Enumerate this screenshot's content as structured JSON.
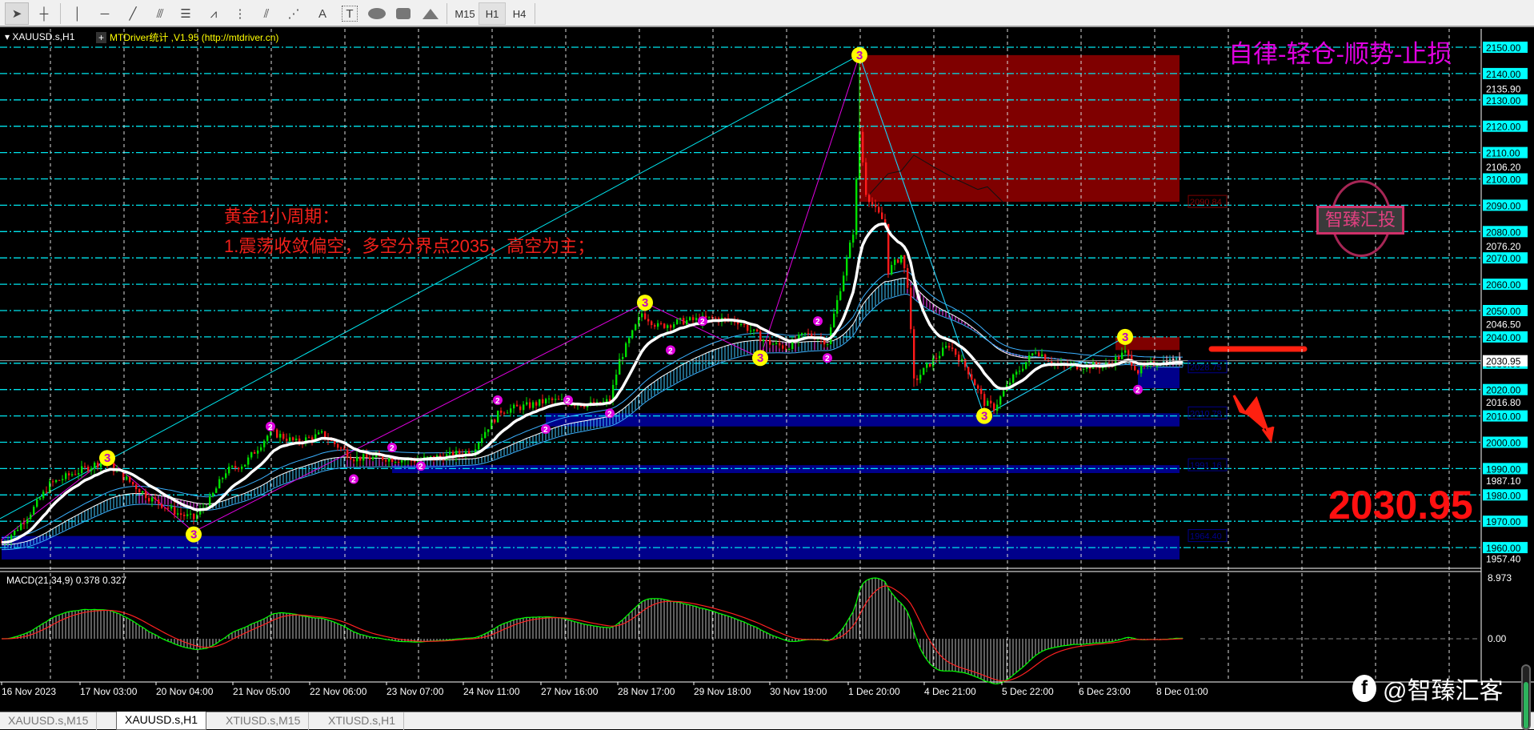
{
  "toolbar": {
    "tools": [
      "cursor",
      "crosshair",
      "vertical-line",
      "horizontal-line",
      "trendline",
      "equidistant-channel",
      "fibonacci-retracement",
      "fibonacci-fan",
      "fibonacci-timezones",
      "fibonacci-channel",
      "gann-fan",
      "text",
      "text-label",
      "ellipse",
      "rectangle",
      "triangle"
    ],
    "text_tool": "A",
    "label_tool": "T",
    "timeframes": [
      "M15",
      "H1",
      "H4"
    ],
    "active_timeframe": "H1"
  },
  "chart": {
    "symbol_label": "XAUUSD.s,H1",
    "indicator_label": "MTDriver统计 ,V1.95 (http://mtdriver.cn)",
    "slogan": "自律-轻仓-顺势-止损",
    "analysis_title": "黄金1小周期：",
    "analysis_line1": "1.震荡收敛偏空，多空分界点2035，高空为主；",
    "big_price": "2030.95",
    "stamp_text": "智臻汇投",
    "stamp_ring_text": "checked",
    "watermark": "@智臻汇客",
    "current_price": 2030.95,
    "current_price_label": "2030.95",
    "price_axis_major": [
      "2150.00",
      "2140.00",
      "2130.00",
      "2120.00",
      "2110.00",
      "2100.00",
      "2090.00",
      "2080.00",
      "2070.00",
      "2060.00",
      "2050.00",
      "2040.00",
      "2030.00",
      "2020.00",
      "2010.00",
      "2000.00",
      "1990.00",
      "1980.00",
      "1970.00",
      "1960.00"
    ],
    "price_axis_minor": [
      "2135.90",
      "2106.20",
      "2076.20",
      "2046.50",
      "2016.80",
      "1987.10",
      "1957.40"
    ],
    "time_labels": [
      "16 Nov 2023",
      "17 Nov 03:00",
      "20 Nov 04:00",
      "21 Nov 05:00",
      "22 Nov 06:00",
      "23 Nov 07:00",
      "24 Nov 11:00",
      "27 Nov 16:00",
      "28 Nov 17:00",
      "29 Nov 18:00",
      "30 Nov 19:00",
      "1 Dec 20:00",
      "4 Dec 21:00",
      "5 Dec 22:00",
      "6 Dec 23:00",
      "8 Dec 01:00"
    ],
    "zones": [
      {
        "kind": "resistance",
        "color": "#7f0000",
        "from_bar": 268,
        "to_bar": 368,
        "top": 2147,
        "bottom": 2091.3,
        "label": "2090.84"
      },
      {
        "kind": "resistance",
        "color": "#7f0000",
        "from_bar": 348,
        "to_bar": 368,
        "top": 2040,
        "bottom": 2035,
        "label": ""
      },
      {
        "kind": "support",
        "color": "#00008b",
        "from_bar": 355,
        "to_bar": 368,
        "top": 2028.5,
        "bottom": 2020.5,
        "label": "2028.75"
      },
      {
        "kind": "support",
        "color": "#00008b",
        "from_bar": 170,
        "to_bar": 368,
        "top": 2011,
        "bottom": 2006,
        "label": "2010.78"
      },
      {
        "kind": "support",
        "color": "#00008b",
        "from_bar": 122,
        "to_bar": 368,
        "top": 1991.3,
        "bottom": 1988.3,
        "label": "1991.16"
      },
      {
        "kind": "support",
        "color": "#00008b",
        "from_bar": 0,
        "to_bar": 368,
        "top": 1964.4,
        "bottom": 1955.5,
        "label": "1964.40"
      }
    ],
    "key_level": {
      "price": 2035.4,
      "from_bar": 377,
      "to_bar": 405
    }
  },
  "chart_data": {
    "type": "candlestick",
    "ylim": [
      1953,
      2151
    ],
    "price_path": [
      [
        0,
        1962
      ],
      [
        4,
        1966
      ],
      [
        10,
        1975
      ],
      [
        15,
        1984
      ],
      [
        22,
        1988
      ],
      [
        32,
        1993
      ],
      [
        40,
        1985
      ],
      [
        46,
        1979
      ],
      [
        55,
        1973
      ],
      [
        60,
        1971
      ],
      [
        65,
        1978
      ],
      [
        70,
        1989
      ],
      [
        76,
        1992
      ],
      [
        84,
        2004
      ],
      [
        92,
        2000
      ],
      [
        100,
        2003
      ],
      [
        110,
        1994
      ],
      [
        120,
        1994
      ],
      [
        128,
        1993
      ],
      [
        140,
        1995
      ],
      [
        147,
        1997
      ],
      [
        152,
        2006
      ],
      [
        156,
        2012
      ],
      [
        165,
        2014
      ],
      [
        171,
        2016
      ],
      [
        178,
        2015
      ],
      [
        186,
        2014
      ],
      [
        190,
        2016
      ],
      [
        193,
        2031
      ],
      [
        200,
        2049
      ],
      [
        205,
        2044
      ],
      [
        213,
        2046
      ],
      [
        222,
        2047
      ],
      [
        230,
        2046
      ],
      [
        239,
        2038
      ],
      [
        245,
        2036
      ],
      [
        251,
        2041
      ],
      [
        255,
        2040
      ],
      [
        258,
        2038
      ],
      [
        263,
        2064
      ],
      [
        266,
        2080
      ],
      [
        268,
        2118
      ],
      [
        270,
        2095
      ],
      [
        273,
        2088
      ],
      [
        276,
        2083
      ],
      [
        277,
        2065
      ],
      [
        281,
        2071
      ],
      [
        283,
        2060
      ],
      [
        285,
        2023
      ],
      [
        290,
        2030
      ],
      [
        296,
        2037
      ],
      [
        302,
        2027
      ],
      [
        307,
        2015
      ],
      [
        310,
        2013
      ],
      [
        315,
        2023
      ],
      [
        323,
        2035
      ],
      [
        330,
        2029
      ],
      [
        345,
        2029
      ],
      [
        351,
        2034
      ],
      [
        355,
        2027
      ],
      [
        360,
        2030
      ],
      [
        364,
        2031
      ],
      [
        370,
        2031
      ]
    ],
    "spike_highs": [
      [
        268,
        2147
      ],
      [
        351,
        2040
      ]
    ],
    "zigzag": [
      [
        0,
        1963
      ],
      [
        33,
        1994
      ],
      [
        60,
        1966
      ],
      [
        201,
        2053
      ],
      [
        237,
        2032
      ],
      [
        268,
        2147
      ],
      [
        307,
        2010
      ],
      [
        351,
        2040
      ]
    ],
    "wave3_points": [
      [
        33,
        1994
      ],
      [
        60,
        1965
      ],
      [
        201,
        2053
      ],
      [
        237,
        2032
      ],
      [
        268,
        2147
      ],
      [
        307,
        2010
      ],
      [
        351,
        2040
      ]
    ],
    "wave2_points": [
      [
        84,
        2006
      ],
      [
        110,
        1986
      ],
      [
        122,
        1998
      ],
      [
        131,
        1991
      ],
      [
        155,
        2016
      ],
      [
        170,
        2005
      ],
      [
        177,
        2016
      ],
      [
        190,
        2011
      ],
      [
        209,
        2035
      ],
      [
        219,
        2046
      ],
      [
        255,
        2046
      ],
      [
        258,
        2032
      ],
      [
        355,
        2020
      ]
    ],
    "inner_curve": [
      [
        271,
        2094
      ],
      [
        277,
        2102
      ],
      [
        281,
        2103
      ],
      [
        285,
        2109
      ],
      [
        292,
        2104
      ],
      [
        298,
        2100
      ],
      [
        305,
        2096
      ],
      [
        308,
        2097
      ],
      [
        313,
        2091
      ]
    ],
    "macd": {
      "label": "MACD(21,34,9) 0.378 0.327",
      "fast": 21,
      "slow": 34,
      "signal": 9,
      "axis_top": "8.973",
      "axis_zero": "0.00"
    }
  },
  "tabs": [
    "XAUUSD.s,M15",
    "XAUUSD.s,H1",
    "XTIUSD.s,M15",
    "XTIUSD.s,H1"
  ],
  "active_tab": "XAUUSD.s,H1"
}
